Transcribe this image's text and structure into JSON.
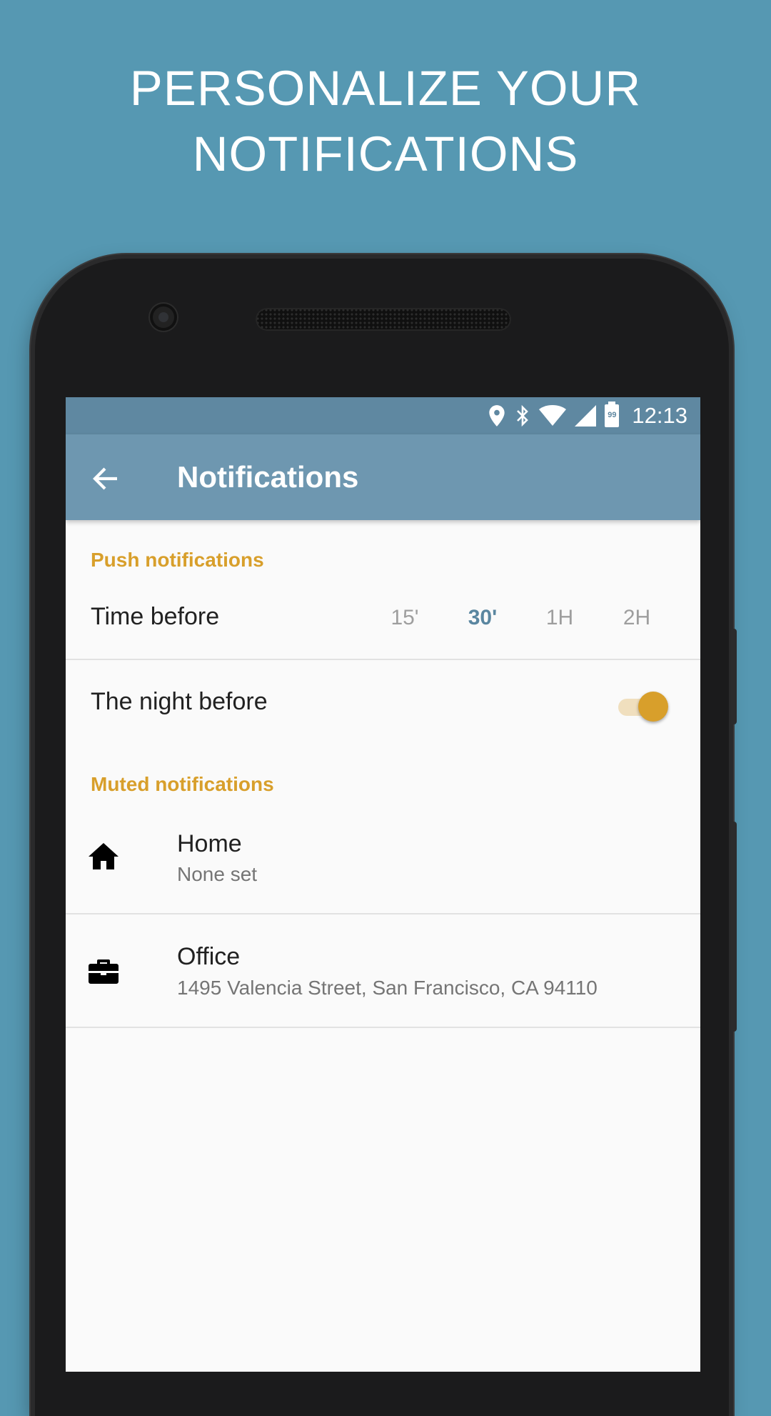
{
  "headline": {
    "line1": "PERSONALIZE YOUR",
    "line2": "NOTIFICATIONS"
  },
  "status_bar": {
    "time": "12:13",
    "battery_level": "99",
    "icons": [
      "location-icon",
      "bluetooth-icon",
      "wifi-icon",
      "signal-icon",
      "battery-icon"
    ]
  },
  "app_bar": {
    "title": "Notifications",
    "back_icon": "arrow-back-icon"
  },
  "push": {
    "header": "Push notifications",
    "time_before_label": "Time before",
    "time_options": [
      "15'",
      "30'",
      "1H",
      "2H"
    ],
    "selected_option": "30'",
    "night_before_label": "The night before",
    "night_before_enabled": true
  },
  "muted": {
    "header": "Muted notifications",
    "items": [
      {
        "title": "Home",
        "subtitle": "None set",
        "icon": "home-icon"
      },
      {
        "title": "Office",
        "subtitle": "1495 Valencia Street, San Francisco, CA 94110",
        "icon": "briefcase-icon"
      }
    ]
  },
  "colors": {
    "background": "#5698b2",
    "accent": "#d89f2b",
    "app_bar": "#6e97b0",
    "status_bar": "#5f88a1",
    "selected_option": "#5a86a0"
  }
}
